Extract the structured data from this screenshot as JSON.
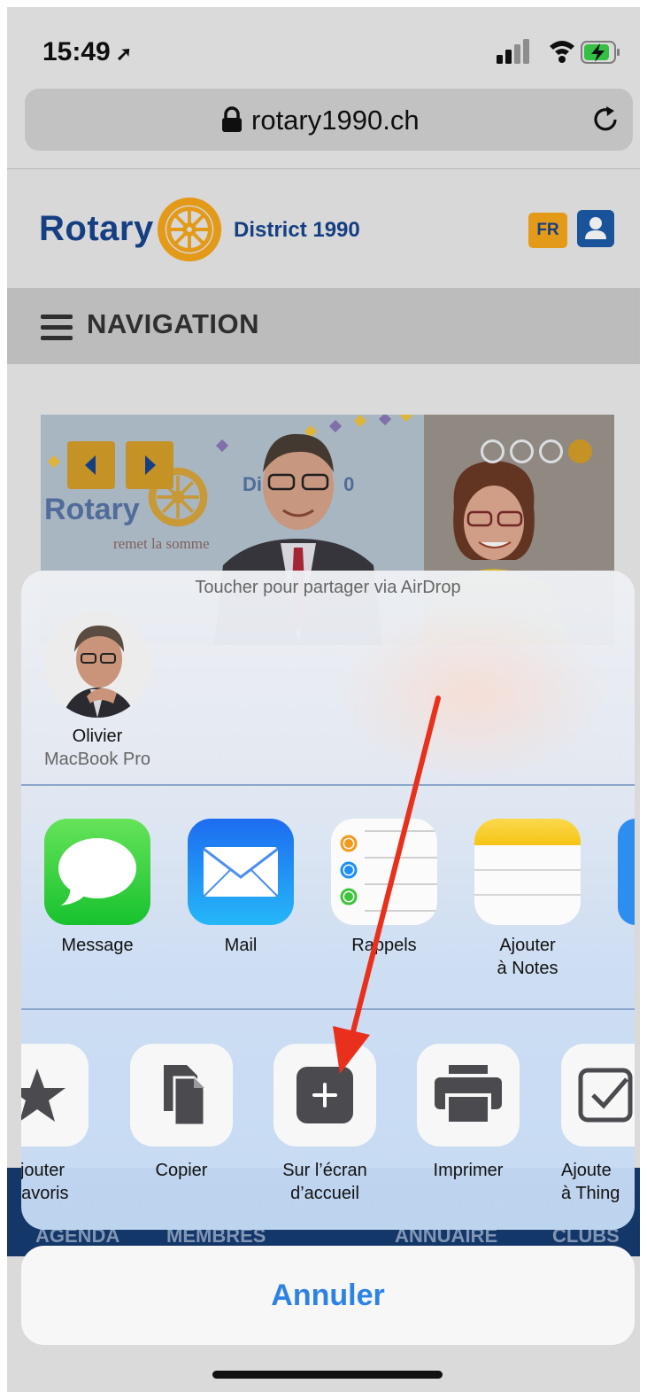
{
  "status_bar": {
    "time": "15:49",
    "location_glyph": "➚",
    "icons": [
      "signal-icon",
      "wifi-icon",
      "battery-charging-icon"
    ]
  },
  "browser": {
    "url": "rotary1990.ch",
    "icons": [
      "lock-icon",
      "reload-icon"
    ]
  },
  "site": {
    "brand": "Rotary",
    "district": "District 1990",
    "lang_button": "FR",
    "nav_label": "NAVIGATION",
    "hero": {
      "banner_brand": "Rotary",
      "banner_district": "Distr",
      "banner_district_tail": "0",
      "banner_caption": "remet la somme"
    },
    "bottom_nav": [
      "AGENDA",
      "MEMBRES",
      "ANNUAIRE",
      "CLUBS"
    ]
  },
  "share_sheet": {
    "airdrop_hint": "Toucher pour partager via AirDrop",
    "airdrop_person": {
      "name": "Olivier",
      "device": "MacBook Pro"
    },
    "apps": [
      {
        "label": "Message",
        "icon": "messages-icon"
      },
      {
        "label": "Mail",
        "icon": "mail-icon"
      },
      {
        "label": "Rappels",
        "icon": "reminders-icon"
      },
      {
        "label_line1": "Ajouter",
        "label_line2": "à Notes",
        "icon": "notes-icon"
      }
    ],
    "actions": [
      {
        "label_line1": "jouter",
        "label_line2": "favoris",
        "icon": "star-icon"
      },
      {
        "label": "Copier",
        "icon": "copy-icon"
      },
      {
        "label_line1": "Sur l’écran",
        "label_line2": "d’accueil",
        "icon": "add-to-home-icon"
      },
      {
        "label": "Imprimer",
        "icon": "print-icon"
      },
      {
        "label_line1": "Ajoute",
        "label_line2": "à Thing",
        "icon": "things-icon"
      }
    ],
    "cancel_label": "Annuler"
  },
  "colors": {
    "rotary_blue": "#17458f",
    "rotary_gold": "#f7a81b",
    "ios_blue": "#2d82e6",
    "arrow_red": "#e8301c"
  }
}
